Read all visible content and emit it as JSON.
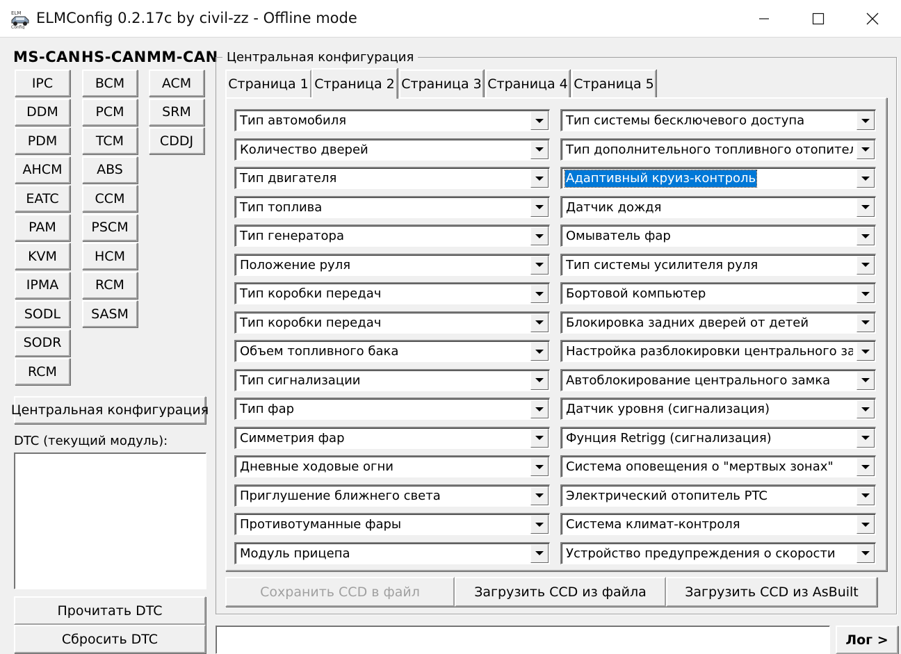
{
  "window": {
    "title": "ELMConfig 0.2.17c by civil-zz - Offline mode",
    "icon": "elm-app-icon",
    "controls": {
      "minimize": "minimize-icon",
      "maximize": "maximize-icon",
      "close": "close-icon"
    }
  },
  "modules": {
    "ms_can": {
      "label": "MS-CAN",
      "items": [
        "IPC",
        "DDM",
        "PDM",
        "AHCM",
        "EATC",
        "PAM",
        "KVM",
        "IPMA",
        "SODL",
        "SODR",
        "RCM"
      ]
    },
    "hs_can": {
      "label": "HS-CAN",
      "items": [
        "BCM",
        "PCM",
        "TCM",
        "ABS",
        "CCM",
        "PSCM",
        "HCM",
        "RCM",
        "SASM"
      ]
    },
    "mm_can": {
      "label": "MM-CAN",
      "items": [
        "ACM",
        "SRM",
        "CDDJ"
      ]
    }
  },
  "left": {
    "central_config_button": "Центральная конфигурация",
    "dtc_label": "DTC (текущий модуль):",
    "read_dtc": "Прочитать DTC",
    "reset_dtc": "Сбросить DTC"
  },
  "central": {
    "group_title": "Центральная конфигурация",
    "tabs": [
      "Страница 1",
      "Страница 2",
      "Страница 3",
      "Страница 4",
      "Страница 5"
    ],
    "active_tab": "Страница 2",
    "left_combos": [
      "Тип автомобиля",
      "Количество дверей",
      "Тип двигателя",
      "Тип топлива",
      "Тип генератора",
      "Положение руля",
      "Тип коробки передач",
      "Тип коробки передач",
      "Объем топливного бака",
      "Тип сигнализации",
      "Тип фар",
      "Симметрия фар",
      "Дневные ходовые огни",
      "Приглушение ближнего света",
      "Противотуманные фары",
      "Модуль прицепа"
    ],
    "right_combos": [
      "Тип системы бесключевого доступа",
      "Тип дополнительного топливного отопителя",
      "Адаптивный круиз-контроль",
      "Датчик дождя",
      "Омыватель фар",
      "Тип системы усилителя руля",
      "Бортовой компьютер",
      "Блокировка задних дверей от детей",
      "Настройка разблокировки центрального замка",
      "Автоблокирование центрального замка",
      "Датчик уровня (сигнализация)",
      "Фунция Retrigg (сигнализация)",
      "Система оповещения о \"мертвых зонах\"",
      "Электрический отопитель PTC",
      "Система климат-контроля",
      "Устройство предупреждения о скорости"
    ],
    "selected_combo": "Адаптивный круиз-контроль",
    "save_ccd": "Сохранить CCD в файл",
    "load_ccd_file": "Загрузить CCD из файла",
    "load_ccd_asbuilt": "Загрузить CCD из AsBuilt"
  },
  "bottom": {
    "status_value": "",
    "log_button": "Лог >"
  },
  "colors": {
    "selection": "#0078d7",
    "face": "#f0f0f0",
    "disabled_text": "#a0a0a0"
  }
}
